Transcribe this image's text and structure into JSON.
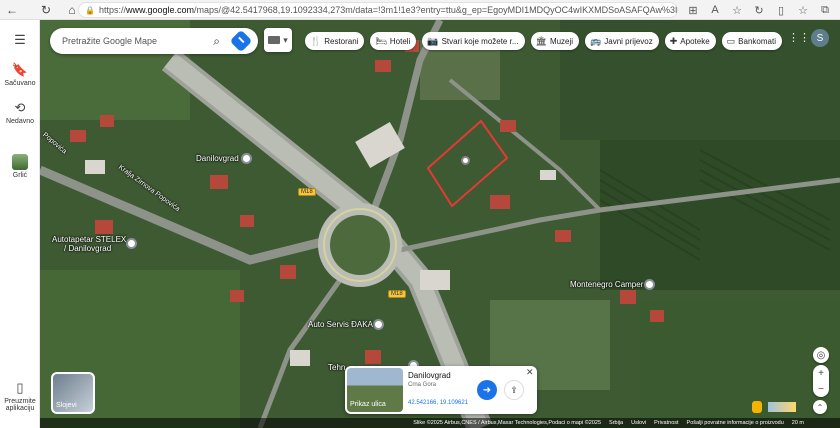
{
  "browser": {
    "url_prefix": "https://",
    "url_host": "www.google.com",
    "url_path": "/maps/@42.5417968,19.1092334,273m/data=!3m1!1e3?entry=ttu&g_ep=EgoyMDI1MDQyOC4wIKXMDSoASAFQAw%3D%3D"
  },
  "search": {
    "placeholder": "Pretražite Google Mape"
  },
  "chips": [
    {
      "icon": "restaurant-icon",
      "glyph": "🍴",
      "label": "Restorani"
    },
    {
      "icon": "hotel-icon",
      "glyph": "🛏",
      "label": "Hoteli"
    },
    {
      "icon": "camera-icon",
      "glyph": "📷",
      "label": "Stvari koje možete r..."
    },
    {
      "icon": "museum-icon",
      "glyph": "🏛",
      "label": "Muzeji"
    },
    {
      "icon": "transit-icon",
      "glyph": "🚌",
      "label": "Javni prijevoz"
    },
    {
      "icon": "pharmacy-icon",
      "glyph": "✚",
      "label": "Apoteke"
    },
    {
      "icon": "atm-icon",
      "glyph": "▭",
      "label": "Bankomati"
    }
  ],
  "avatar_letter": "S",
  "sidebar": {
    "saved": "Sačuvano",
    "recent": "Nedavno",
    "place": "Grlić",
    "download_1": "Preuzmite",
    "download_2": "aplikaciju"
  },
  "map": {
    "poi": {
      "danilovgrad": "Danilovgrad",
      "stelex_1": "Autotapetar STELEX",
      "stelex_2": "/ Danilovgrad",
      "camper": "Montenegro Camper",
      "autoservis": "Auto Servis ĐAKA",
      "street": "Kralja Zirnova Popovića",
      "street_short": "Popovića",
      "partial": "Tehn"
    },
    "road_1": "M18",
    "road_2": "M18",
    "layers_label": "Slojevi"
  },
  "card": {
    "title": "Danilovgrad",
    "subtitle": "Crna Gora",
    "coords": "42.542166, 19.109621",
    "street_view": "Prikaz ulica"
  },
  "footer": {
    "attribution": "Slike ©2025 Airbus,CNES / Airbus,Maxar Technologies,Podaci o mapi ©2025",
    "links": [
      "Srbija",
      "Uslovi",
      "Privatnost",
      "Pošalji povratne informacije o proizvodu"
    ],
    "scale": "20 m"
  },
  "colors": {
    "accent": "#1a73e8",
    "highlight": "#e53935"
  }
}
